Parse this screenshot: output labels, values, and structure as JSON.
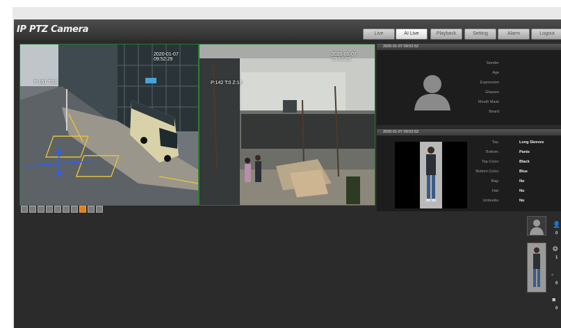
{
  "app": {
    "title": "IP PTZ Camera"
  },
  "nav": {
    "tabs": [
      {
        "label": "Live",
        "active": false
      },
      {
        "label": "AI Live",
        "active": true
      },
      {
        "label": "Playback",
        "active": false
      },
      {
        "label": "Setting",
        "active": false
      },
      {
        "label": "Alarm",
        "active": false
      },
      {
        "label": "Logout",
        "active": false
      }
    ]
  },
  "video": {
    "left": {
      "timestamp": "2020-01-07 09:52:29",
      "position": "P:151 T:21"
    },
    "right": {
      "timestamp": "2020-01-07 09:52:29",
      "position": "P:142 T:0 Z:16"
    },
    "toolbar_active_index": 7
  },
  "face_panel": {
    "header": "2020-01-07 09:52:52",
    "attributes": [
      {
        "label": "Gender"
      },
      {
        "label": "Age"
      },
      {
        "label": "Expression"
      },
      {
        "label": "Glasses"
      },
      {
        "label": "Mouth Mask"
      },
      {
        "label": "Beard"
      }
    ]
  },
  "body_panel": {
    "header": "2020-01-07 09:52:52",
    "attributes": [
      {
        "label": "Top:",
        "value": "Long Sleeves"
      },
      {
        "label": "Bottom:",
        "value": "Pants"
      },
      {
        "label": "Top Color:",
        "value": "Black"
      },
      {
        "label": "Bottom Color:",
        "value": "Blue"
      },
      {
        "label": "Bag:",
        "value": "No"
      },
      {
        "label": "Hat:",
        "value": "No"
      },
      {
        "label": "Umbrella:",
        "value": "No"
      }
    ]
  },
  "stats": {
    "counts": [
      "0",
      "1",
      "0",
      "0"
    ],
    "icons": [
      "person-icon",
      "pedestrian-icon",
      "bicycle-icon",
      "vehicle-icon"
    ]
  },
  "colors": {
    "accent": "#e0801a",
    "frame_green": "#2f7d2f"
  }
}
